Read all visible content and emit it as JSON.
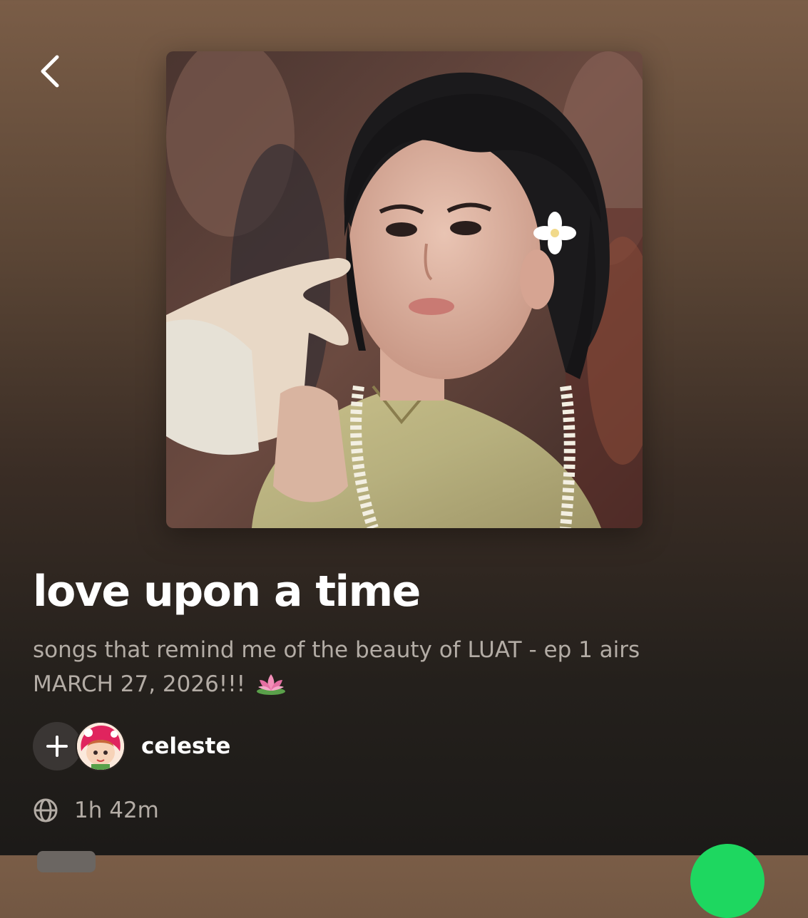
{
  "playlist": {
    "title": "love upon a time",
    "description_line1": "songs that remind me of the beauty of LUAT - ep 1 airs",
    "description_line2": "MARCH 27, 2026!!!",
    "emoji_icon": "lotus-icon",
    "owner_name": "celeste",
    "duration": "1h 42m"
  },
  "icons": {
    "back": "chevron-left-icon",
    "add": "plus-icon",
    "visibility": "globe-icon"
  },
  "colors": {
    "play_accent": "#1ed760",
    "secondary_text": "#b3aca5",
    "background_top": "#7a5d47",
    "background_bottom": "#1c1a18"
  }
}
